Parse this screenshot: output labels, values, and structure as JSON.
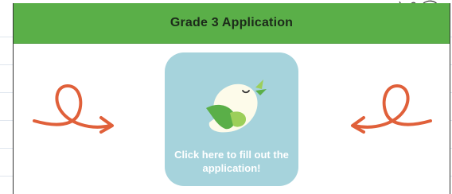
{
  "header": {
    "title": "Grade 3 Application"
  },
  "cta": {
    "line1": "Click here to fill out the",
    "line2": "application!"
  },
  "colors": {
    "header_bg": "#5aaf48",
    "button_bg": "#a6d3dc",
    "arrow": "#e0603a",
    "bird_body": "#fdfbea",
    "bird_wing": "#5aaf48",
    "bird_wing_light": "#9ccf5a"
  },
  "icons": {
    "bird": "bird-icon",
    "left_arrow": "swirl-arrow-right-icon",
    "right_arrow": "swirl-arrow-left-icon"
  }
}
